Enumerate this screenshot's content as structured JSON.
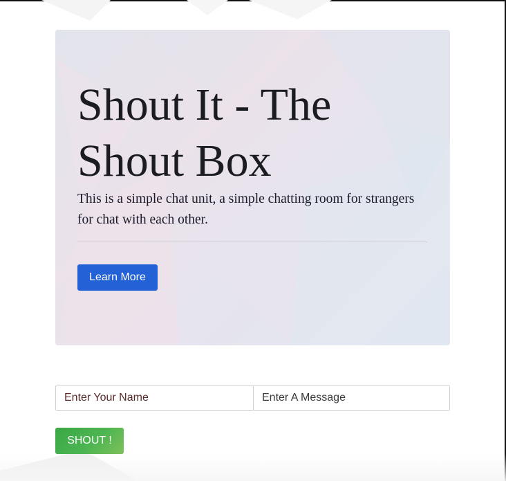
{
  "hero": {
    "title": "Shout It - The Shout Box",
    "lead": "This is a simple chat unit, a simple chatting room for strangers for chat with each other.",
    "learn_more_label": "Learn More"
  },
  "form": {
    "name_placeholder": "Enter Your Name",
    "message_placeholder": "Enter A Message",
    "shout_label": "SHOUT !"
  },
  "colors": {
    "primary_button": "#2262d6",
    "success_button": "#4cb552"
  }
}
